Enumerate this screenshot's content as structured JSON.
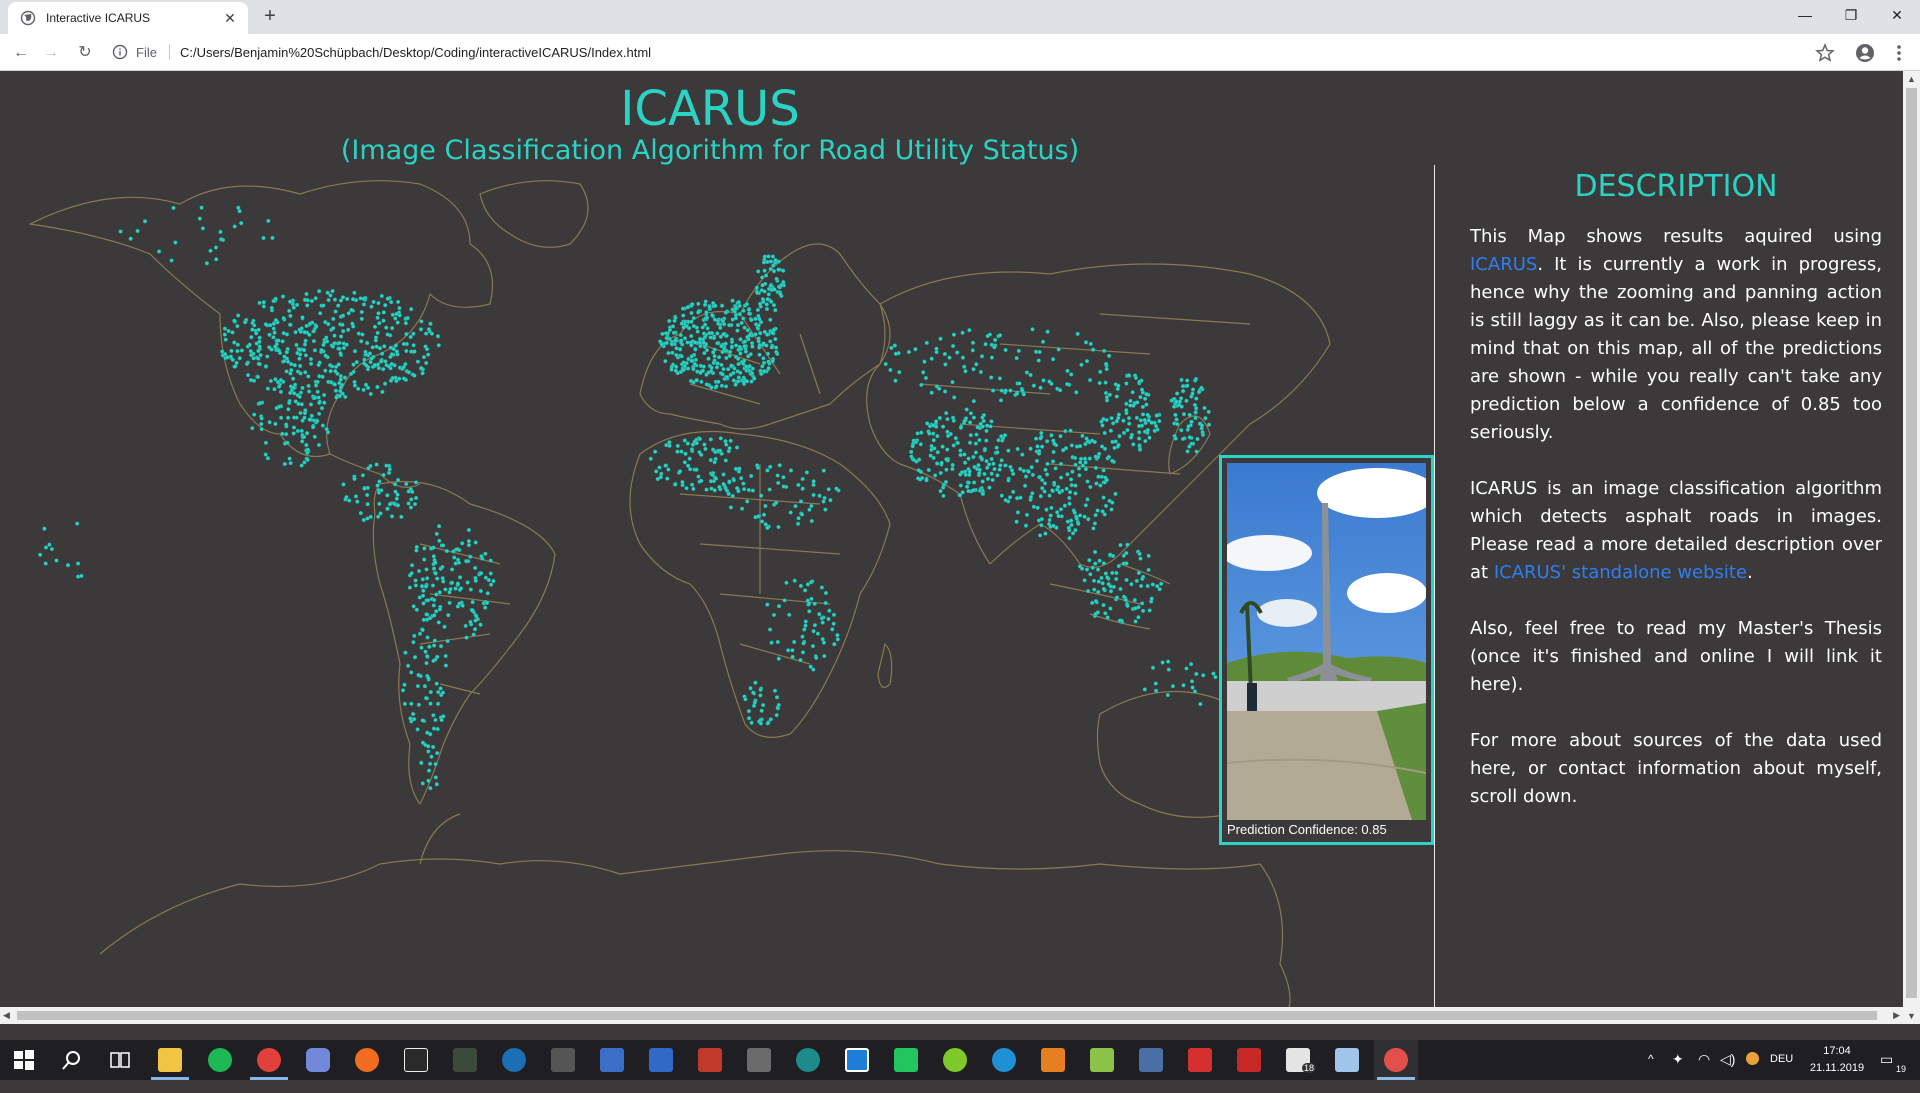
{
  "browser": {
    "tab_title": "Interactive ICARUS",
    "new_tab": "+",
    "url_scheme": "File",
    "url": "C:/Users/Benjamin%20Schüpbach/Desktop/Coding/interactiveICARUS/Index.html"
  },
  "page": {
    "title": "ICARUS",
    "subtitle": "(Image Classification Algorithm for Road Utility Status)",
    "accent_color": "#2bd3c4",
    "link_color": "#2f7ff0"
  },
  "description": {
    "heading": "DESCRIPTION",
    "p1_before": "This Map shows results aquired using ",
    "p1_link": "ICARUS",
    "p1_after": ". It is currently a work in progress, hence why the zooming and panning action is still laggy as it can be. Also, please keep in mind that on this map, all of the predictions are shown - while you really can't take any prediction below a confidence of 0.85 too seriously.",
    "p2_before": "ICARUS is an image classification algorithm which detects asphalt roads in images. Please read a more detailed description over at ",
    "p2_link": "ICARUS' standalone website",
    "p2_after": ".",
    "p3": "Also, feel free to read my Master's Thesis (once it's finished and online I will link it here).",
    "p4": "For more about sources of the data used here, or contact information about myself, scroll down."
  },
  "popup": {
    "caption": "Prediction Confidence: 0.85"
  },
  "taskbar": {
    "language": "DEU",
    "time": "17:04",
    "date": "21.11.2019",
    "mail_badge": "18",
    "notification_count": "19"
  }
}
